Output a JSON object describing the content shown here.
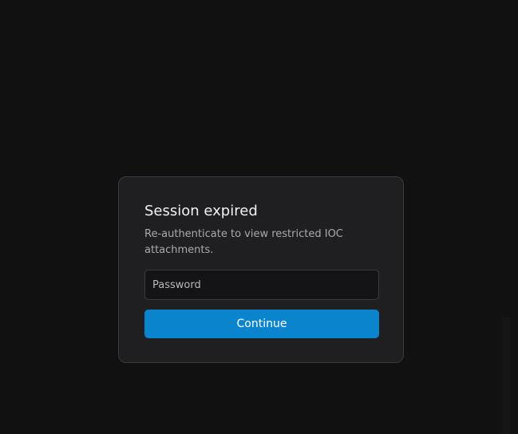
{
  "modal": {
    "title": "Session expired",
    "description": "Re-authenticate to view restricted IOC attachments.",
    "password_placeholder": "Password",
    "continue_label": "Continue"
  },
  "colors": {
    "accent": "#0a84cc",
    "backdrop": "#111111",
    "modal_background": "#1f1f22"
  }
}
